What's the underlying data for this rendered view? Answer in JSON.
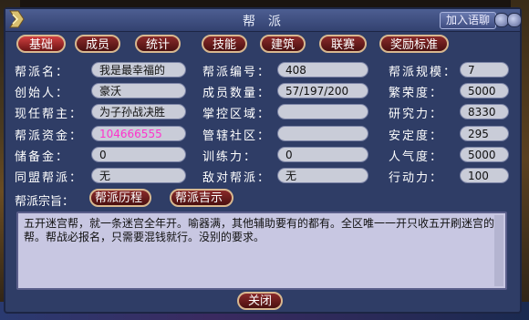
{
  "window": {
    "title": "帮派",
    "join_chat": "加入语聊"
  },
  "tabs": [
    "基础",
    "成员",
    "统计",
    "技能",
    "建筑",
    "联赛",
    "奖励标准"
  ],
  "fields": {
    "col1": [
      {
        "label": "帮派名：",
        "value": "我是最幸福的"
      },
      {
        "label": "创始人：",
        "value": "豪沃"
      },
      {
        "label": "现任帮主：",
        "value": "为子孙战决胜"
      },
      {
        "label": "帮派资金：",
        "value": "104666555"
      },
      {
        "label": "储备金：",
        "value": "0"
      },
      {
        "label": "同盟帮派：",
        "value": "无"
      }
    ],
    "col2": [
      {
        "label": "帮派编号：",
        "value": "408"
      },
      {
        "label": "成员数量：",
        "value": "57/197/200"
      },
      {
        "label": "掌控区域：",
        "value": ""
      },
      {
        "label": "管辖社区：",
        "value": ""
      },
      {
        "label": "训练力：",
        "value": "0"
      },
      {
        "label": "敌对帮派：",
        "value": "无"
      }
    ],
    "col3": [
      {
        "label": "帮派规模：",
        "value": "7"
      },
      {
        "label": "繁荣度：",
        "value": "5000"
      },
      {
        "label": "研究力：",
        "value": "8330"
      },
      {
        "label": "安定度：",
        "value": "295"
      },
      {
        "label": "人气度：",
        "value": "5000"
      },
      {
        "label": "行动力：",
        "value": "100"
      }
    ]
  },
  "purpose": {
    "label": "帮派宗旨：",
    "history_btn": "帮派历程",
    "notice_btn": "帮派吉示"
  },
  "description": "五开迷宫帮，就一条迷宫全年开。喻器满，其他辅助要有的都有。全区唯一一开只收五开刷迷宫的帮。帮战必报名，只需要混钱就行。没别的要求。",
  "close_btn": "关闭"
}
